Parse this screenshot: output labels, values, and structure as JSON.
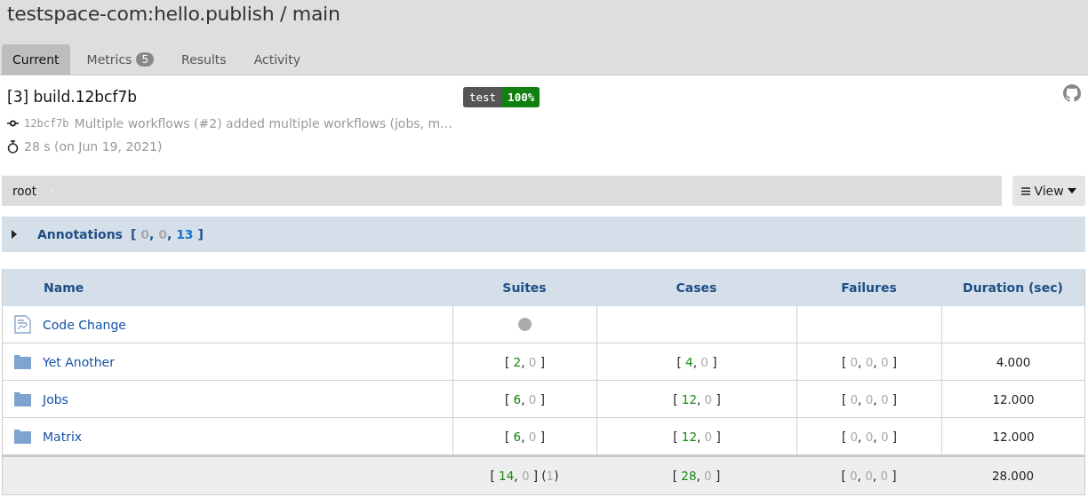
{
  "window": {
    "title": "testspace-com:hello.publish / main"
  },
  "tabs": [
    {
      "label": "Current",
      "selected": true
    },
    {
      "label": "Metrics",
      "badge": "5",
      "selected": false
    },
    {
      "label": "Results",
      "selected": false
    },
    {
      "label": "Activity",
      "selected": false
    }
  ],
  "build": {
    "title": "[3] build.12bcf7b",
    "badge_label": "test",
    "badge_value": "100%",
    "commit_hash": "12bcf7b",
    "commit_message": "Multiple workflows (#2) added multiple workflows (jobs, m…",
    "duration": "28 s (on Jun 19, 2021)"
  },
  "breadcrumb": [
    "root"
  ],
  "view_button": "View",
  "annotations": {
    "label": "Annotations",
    "expanded": false,
    "counts": [
      "[ ",
      "0",
      ", ",
      "0",
      ", ",
      "13",
      " ]"
    ]
  },
  "table": {
    "columns": [
      "Name",
      "Suites",
      "Cases",
      "Failures",
      "Duration (sec)"
    ],
    "rows": [
      {
        "kind": "code_change",
        "name": "Code Change",
        "suites_dot": true
      },
      {
        "kind": "folder",
        "name": "Yet Another",
        "suites": [
          "[ ",
          "2",
          ", ",
          "0",
          " ]"
        ],
        "cases": [
          "[ ",
          "4",
          ", ",
          "0",
          " ]"
        ],
        "failures": [
          "[ ",
          "0",
          ", ",
          "0",
          ", ",
          "0",
          " ]"
        ],
        "duration": "4.000"
      },
      {
        "kind": "folder",
        "name": "Jobs",
        "suites": [
          "[ ",
          "6",
          ", ",
          "0",
          " ]"
        ],
        "cases": [
          "[ ",
          "12",
          ", ",
          "0",
          " ]"
        ],
        "failures": [
          "[ ",
          "0",
          ", ",
          "0",
          ", ",
          "0",
          " ]"
        ],
        "duration": "12.000"
      },
      {
        "kind": "folder",
        "name": "Matrix",
        "suites": [
          "[ ",
          "6",
          ", ",
          "0",
          " ]"
        ],
        "cases": [
          "[ ",
          "12",
          ", ",
          "0",
          " ]"
        ],
        "failures": [
          "[ ",
          "0",
          ", ",
          "0",
          ", ",
          "0",
          " ]"
        ],
        "duration": "12.000"
      }
    ],
    "totals": {
      "suites": [
        "[ ",
        "14",
        ", ",
        "0",
        " ] (",
        "1",
        ")"
      ],
      "cases": [
        "[ ",
        "28",
        ", ",
        "0",
        " ]"
      ],
      "failures": [
        "[ ",
        "0",
        ", ",
        "0",
        ", ",
        "0",
        " ]"
      ],
      "duration": "28.000"
    }
  }
}
